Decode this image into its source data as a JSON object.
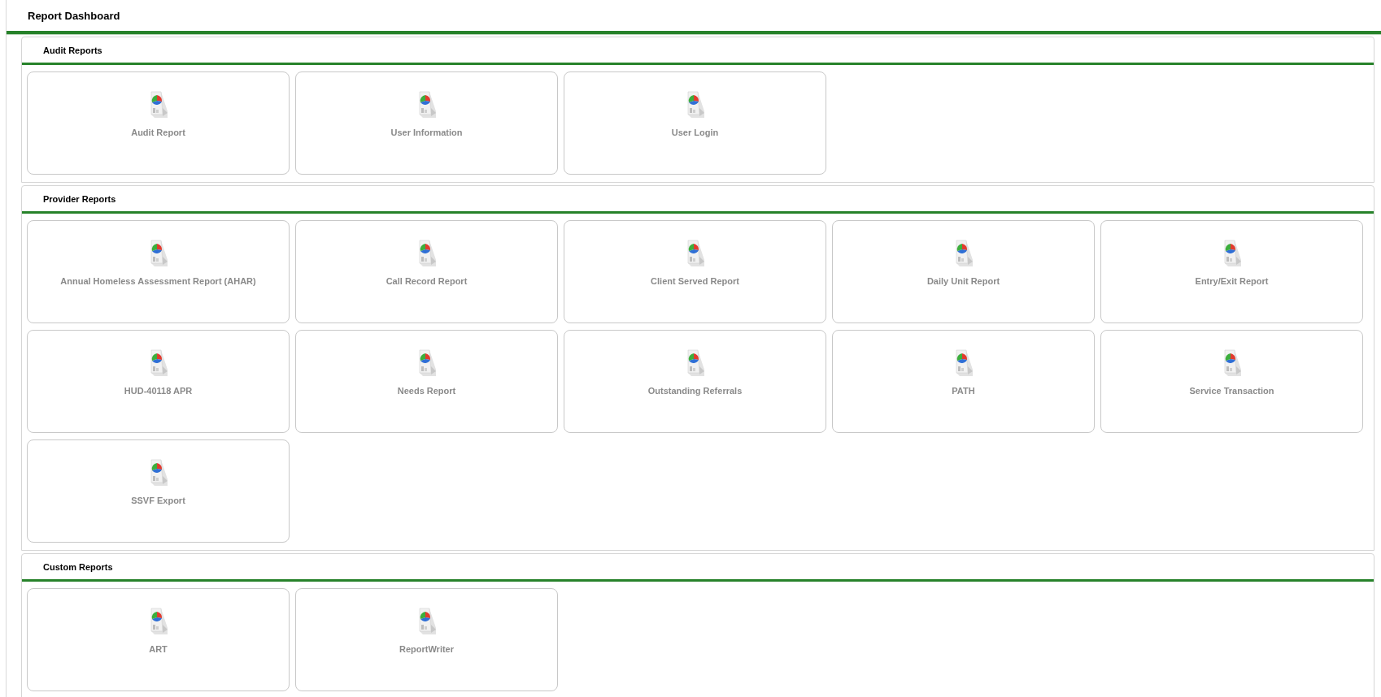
{
  "page": {
    "title": "Report Dashboard"
  },
  "sections": [
    {
      "title": "Audit Reports",
      "reports": [
        "Audit Report",
        "User Information",
        "User Login"
      ]
    },
    {
      "title": "Provider Reports",
      "reports": [
        "Annual Homeless Assessment Report (AHAR)",
        "Call Record Report",
        "Client Served Report",
        "Daily Unit Report",
        "Entry/Exit Report",
        "HUD-40118 APR",
        "Needs Report",
        "Outstanding Referrals",
        "PATH",
        "Service Transaction",
        "SSVF Export"
      ]
    },
    {
      "title": "Custom Reports",
      "reports": [
        "ART",
        "ReportWriter"
      ]
    }
  ]
}
